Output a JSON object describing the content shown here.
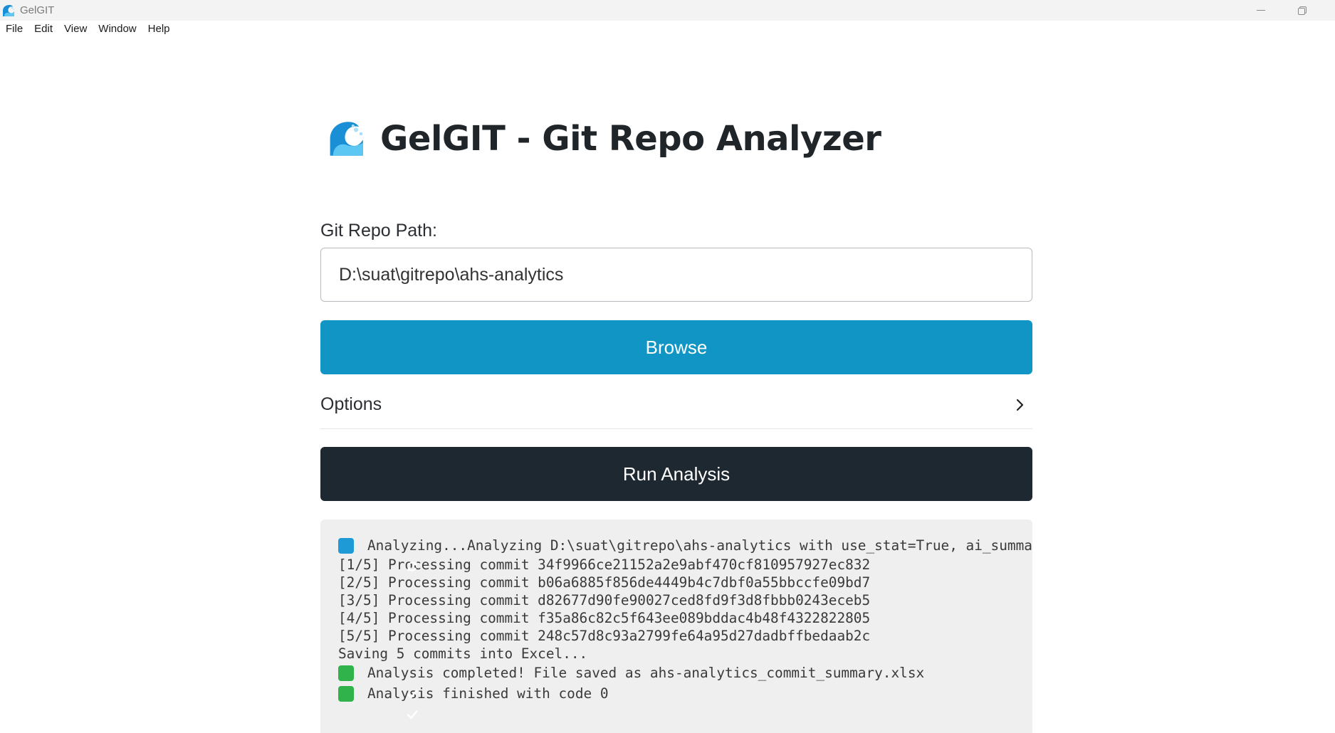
{
  "window": {
    "title": "GelGIT",
    "app_icon": "wave-logo-icon",
    "controls": [
      "minimize",
      "restore"
    ]
  },
  "menu": {
    "items": [
      "File",
      "Edit",
      "View",
      "Window",
      "Help"
    ]
  },
  "header": {
    "title": "GelGIT - Git Repo Analyzer",
    "logo": "wave-logo-icon"
  },
  "form": {
    "path_label": "Git Repo Path:",
    "path_value": "D:\\suat\\gitrepo\\ahs-analytics",
    "browse_label": "Browse",
    "options_label": "Options",
    "run_label": "Run Analysis"
  },
  "colors": {
    "browse_bg": "#1195c4",
    "run_bg": "#1e2830",
    "log_bg": "#efefef"
  },
  "log": {
    "lines": [
      {
        "icon": "sync-icon",
        "text": "Analyzing...Analyzing D:\\suat\\gitrepo\\ahs-analytics with use_stat=True, ai_summary=False"
      },
      {
        "icon": "",
        "text": "[1/5] Processing commit 34f9966ce21152a2e9abf470cf810957927ec832"
      },
      {
        "icon": "",
        "text": "[2/5] Processing commit b06a6885f856de4449b4c7dbf0a55bbccfe09bd7"
      },
      {
        "icon": "",
        "text": "[3/5] Processing commit d82677d90fe90027ced8fd9f3d8fbbb0243eceb5"
      },
      {
        "icon": "",
        "text": "[4/5] Processing commit f35a86c82c5f643ee089bddac4b48f4322822805"
      },
      {
        "icon": "",
        "text": "[5/5] Processing commit 248c57d8c93a2799fe64a95d27dadbffbedaab2c"
      },
      {
        "icon": "",
        "text": "Saving 5 commits into Excel..."
      },
      {
        "icon": "check-icon",
        "text": "Analysis completed! File saved as ahs-analytics_commit_summary.xlsx"
      },
      {
        "icon": "check-icon",
        "text": "Analysis finished with code 0"
      }
    ]
  }
}
